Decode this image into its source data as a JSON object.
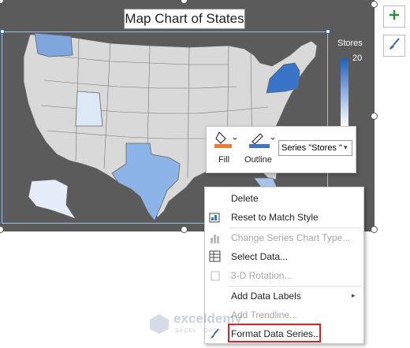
{
  "chart": {
    "title": "Map Chart of States",
    "legend_title": "Stores",
    "legend_max": "20",
    "legend_gradient": [
      "#1f5fbf",
      "#ffffff"
    ]
  },
  "side_buttons": {
    "add_icon": "plus-icon",
    "style_icon": "brush-icon"
  },
  "format_toolbar": {
    "fill_label": "Fill",
    "outline_label": "Outline",
    "series_selected": "Series \"Stores \""
  },
  "context_menu": {
    "items": [
      {
        "label": "Delete",
        "disabled": false,
        "icon": ""
      },
      {
        "label": "Reset to Match Style",
        "disabled": false,
        "icon": "reset-style-icon"
      },
      {
        "label": "Change Series Chart Type...",
        "disabled": true,
        "icon": "chart-type-icon"
      },
      {
        "label": "Select Data...",
        "disabled": false,
        "icon": "select-data-icon"
      },
      {
        "label": "3-D Rotation...",
        "disabled": true,
        "icon": "rotation-icon"
      },
      {
        "label": "Add Data Labels",
        "disabled": false,
        "icon": ""
      },
      {
        "label": "Add Trendline...",
        "disabled": true,
        "icon": ""
      },
      {
        "label": "Format Data Series...",
        "disabled": false,
        "icon": "format-series-icon"
      }
    ]
  },
  "watermark": {
    "brand": "exceldemy",
    "tagline": "EXCEL · DATA · BI"
  },
  "colors": {
    "chart_bg": "#5b5b5b",
    "state_default": "#d9d9d9",
    "highlight_red": "#e0201e"
  }
}
